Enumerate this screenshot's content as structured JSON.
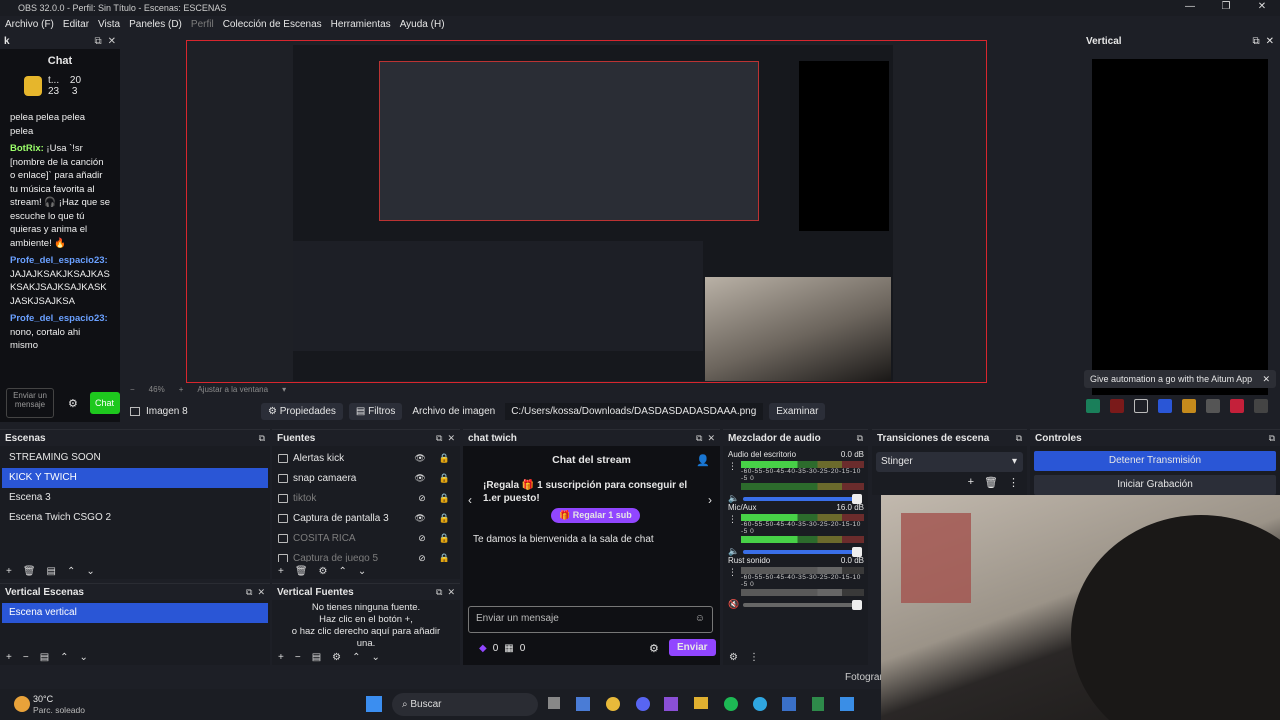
{
  "window_title": "OBS 32.0.0 - Perfil: Sin Título - Escenas: ESCENAS",
  "menu": [
    "Archivo (F)",
    "Editar",
    "Vista",
    "Paneles (D)",
    "Perfil",
    "Colección de Escenas",
    "Herramientas",
    "Ayuda (H)"
  ],
  "chat_dock": {
    "title": "k",
    "header": "Chat",
    "stats": {
      "top_user": "t...",
      "count1": "20",
      "count2": "23",
      "count3": "3"
    },
    "lines": [
      {
        "user": "",
        "text": "pelea pelea pelea pelea"
      },
      {
        "user": "BotRix:",
        "text": "¡Usa `!sr [nombre de la canción o enlace]` para añadir tu música favorita al stream! 🎧 ¡Haz que se escuche lo que tú quieras y anima el ambiente! 🔥"
      },
      {
        "user": "Profe_del_espacio23:",
        "text": "JAJAJKSAKJKSAJKASKSAKJSAJKSAJKASKJASKJSAJKSA"
      },
      {
        "user": "Profe_del_espacio23:",
        "text": "nono, cortalo ahi mismo"
      }
    ],
    "input_placeholder": "Enviar un mensaje",
    "send_label": "Chat"
  },
  "zoom": {
    "level": "46%",
    "fit_label": "Ajustar a la ventana"
  },
  "vertical_dock": {
    "title": "Vertical",
    "aitum_text": "Give automation a go with the Aitum App"
  },
  "source_bar": {
    "source_name": "Imagen 8",
    "properties_label": "Propiedades",
    "filters_label": "Filtros",
    "file_label": "Archivo de imagen",
    "path": "C:/Users/kossa/Downloads/DASDASDADASDAAA.png",
    "browse_label": "Examinar"
  },
  "scenes": {
    "title": "Escenas",
    "items": [
      "STREAMING SOON",
      "KICK Y TWICH",
      "Escena 3",
      "Escena Twich CSGO 2"
    ],
    "selected": 1
  },
  "sources": {
    "title": "Fuentes",
    "items": [
      {
        "name": "Alertas kick",
        "visible": true
      },
      {
        "name": "snap camaera",
        "visible": true
      },
      {
        "name": "tiktok",
        "visible": false
      },
      {
        "name": "Captura de pantalla 3",
        "visible": true
      },
      {
        "name": "COSITA RICA",
        "visible": false
      },
      {
        "name": "Captura de juego 5",
        "visible": false
      }
    ]
  },
  "vertical_scenes": {
    "title": "Vertical Escenas",
    "items": [
      "Escena vertical"
    ]
  },
  "vertical_sources": {
    "title": "Vertical Fuentes",
    "empty_lines": [
      "No tienes ninguna fuente.",
      "Haz clic en el botón +,",
      "o haz clic derecho aquí para añadir",
      "una."
    ]
  },
  "twitch_chat": {
    "title": "chat twich",
    "header": "Chat del stream",
    "promo_text": "¡Regala 🎁 1 suscripción para conseguir el 1.er puesto!",
    "gift_button": "Regalar 1 sub",
    "welcome": "Te damos la bienvenida a la sala de chat",
    "input_placeholder": "Enviar un mensaje",
    "points1": "0",
    "points2": "0",
    "send_label": "Enviar"
  },
  "mixer": {
    "title": "Mezclador de audio",
    "channels": [
      {
        "name": "Audio del escritorio",
        "db": "0.0 dB",
        "muted": false
      },
      {
        "name": "Mic/Aux",
        "db": "16.0 dB",
        "muted": false
      },
      {
        "name": "Rust sonido",
        "db": "0.0 dB",
        "muted": true
      }
    ],
    "scale": "-60-55-50-45-40-35-30-25-20-15-10 -5 0"
  },
  "transitions": {
    "title": "Transiciones de escena",
    "selected": "Stinger"
  },
  "controls": {
    "title": "Controles",
    "stop_stream": "Detener Transmisión",
    "start_record": "Iniciar Grabación"
  },
  "status_partial": "Fotogram",
  "taskbar": {
    "weather_temp": "30°C",
    "weather_desc": "Parc. soleado",
    "search": "Buscar"
  }
}
